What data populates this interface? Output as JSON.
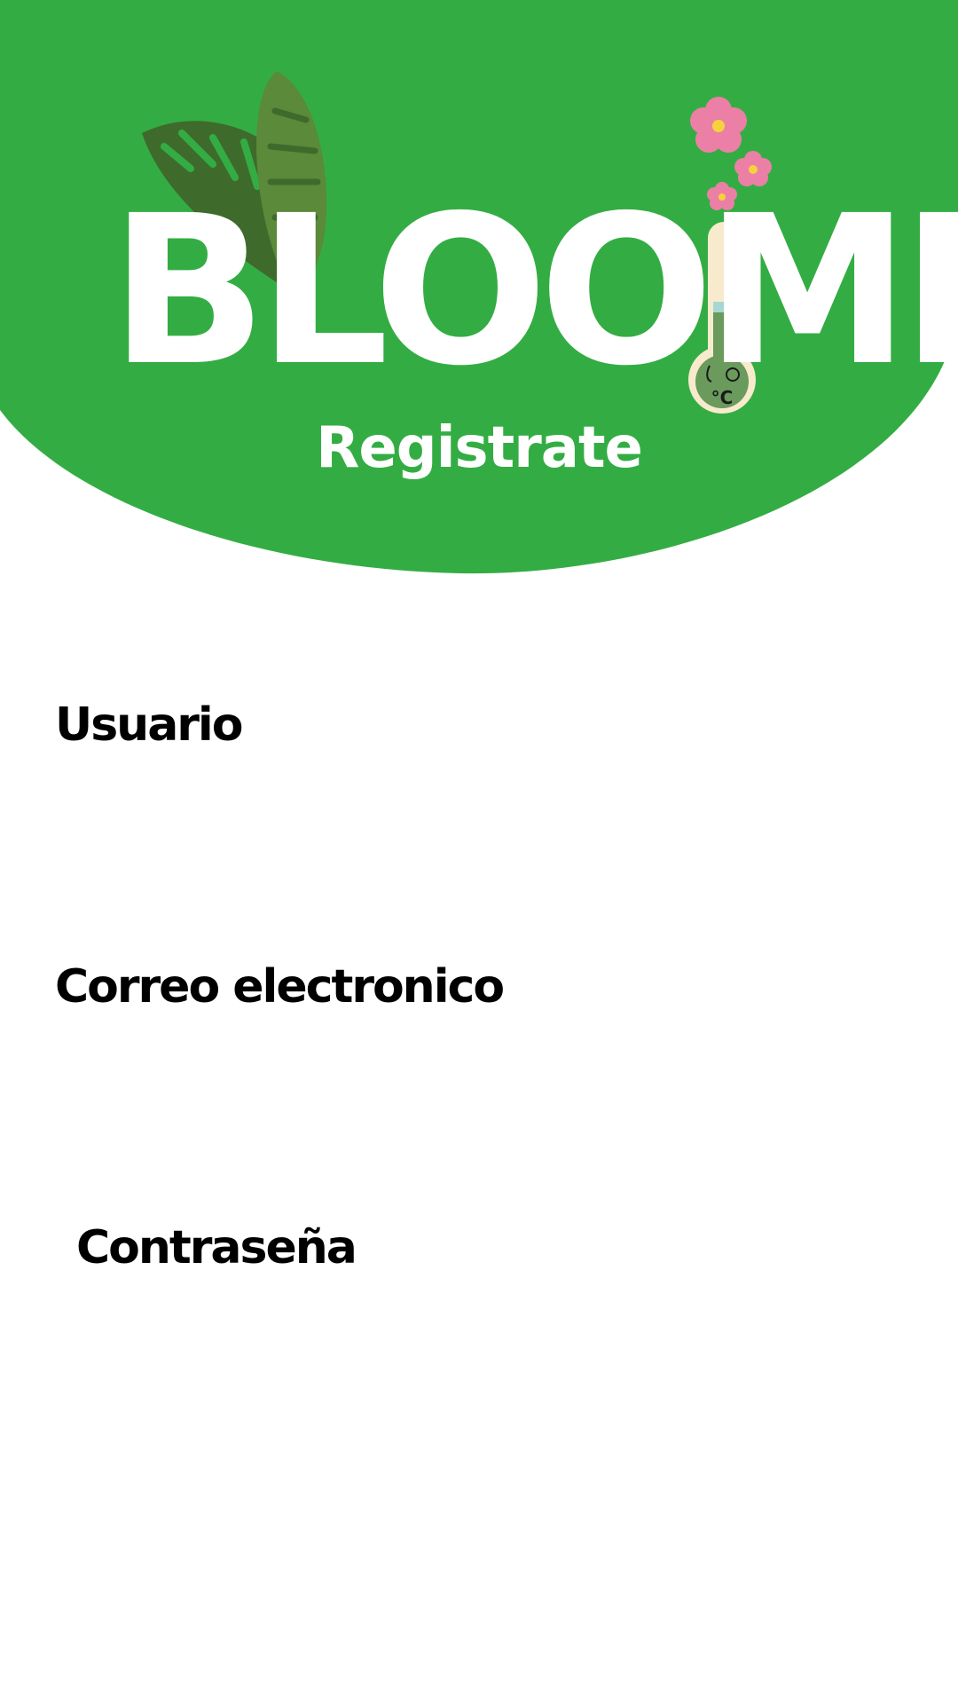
{
  "app": {
    "logo_text": "BLOOMIE",
    "subtitle": "Registrate"
  },
  "form": {
    "username_label": "Usuario",
    "email_label": "Correo electronico",
    "password_label": "Contraseña",
    "username_value": "",
    "email_value": "",
    "password_value": ""
  },
  "colors": {
    "header_green": "#33ad43",
    "background": "#ffffff",
    "label_text": "#000000",
    "thermometer_cream": "#f8ebcd",
    "flower_pink": "#ec7fa6",
    "leaf_dark": "#3e6b2c",
    "leaf_light": "#5a8a3a"
  },
  "icons": {
    "leaf": "monstera-leaf-icon",
    "flower": "pink-flower-icon",
    "thermometer": "thermometer-icon"
  }
}
